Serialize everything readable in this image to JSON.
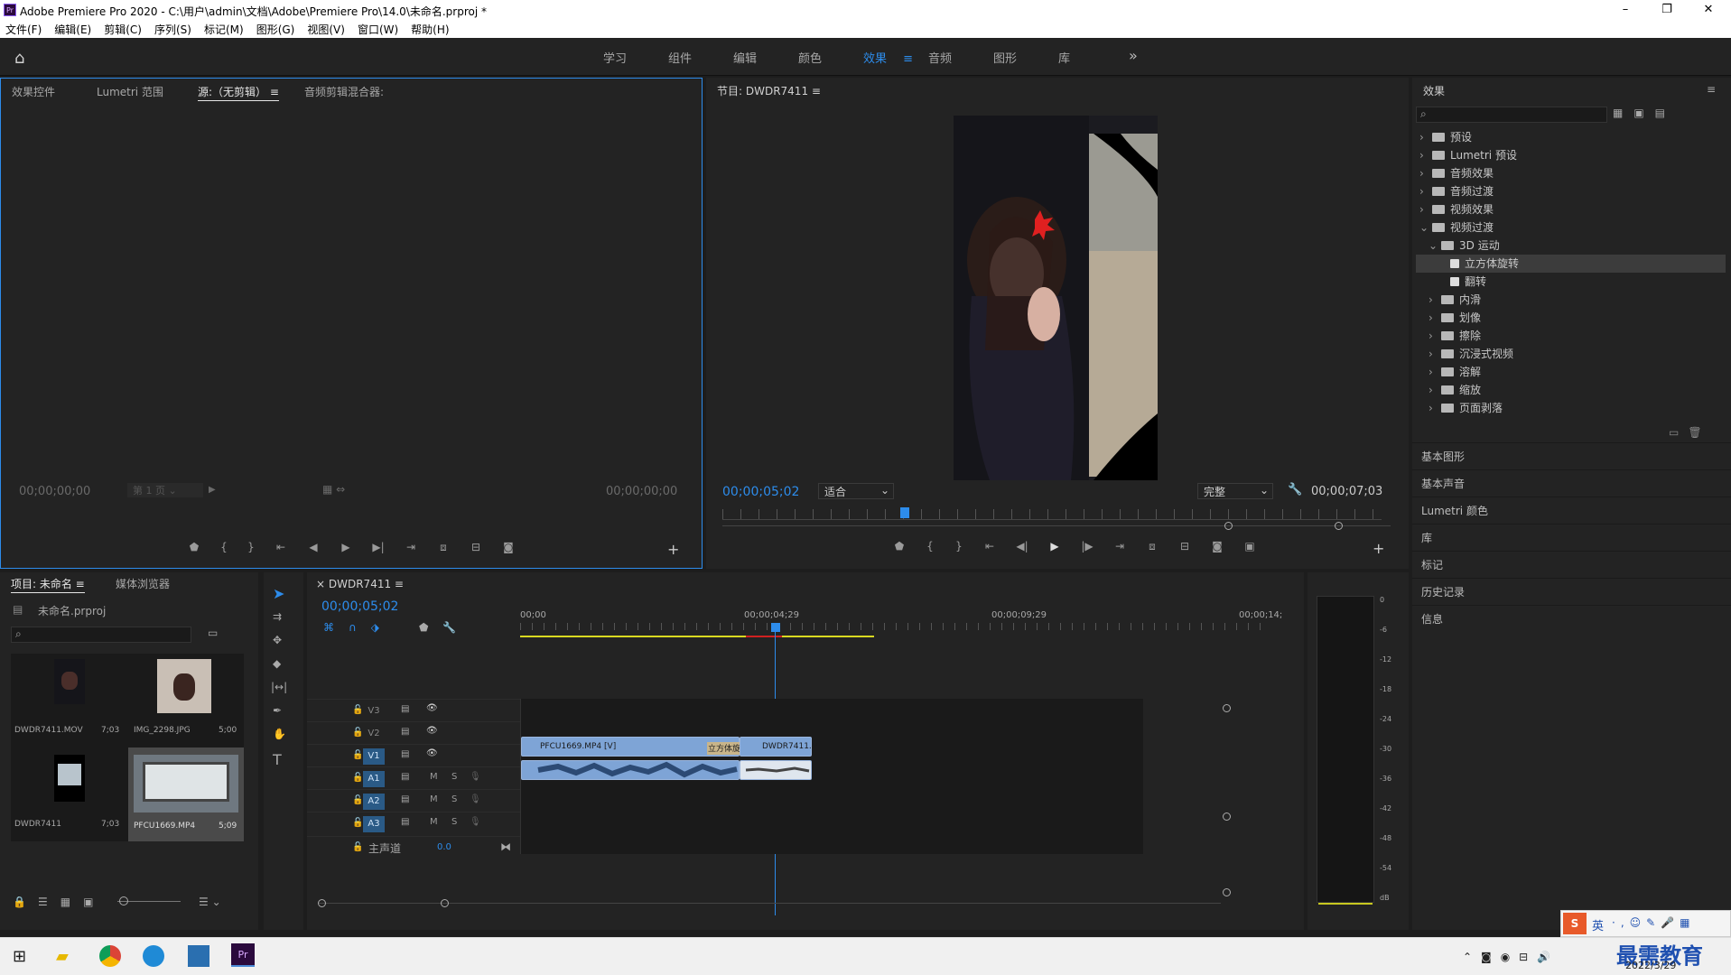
{
  "window": {
    "title": "Adobe Premiere Pro 2020 - C:\\用户\\admin\\文档\\Adobe\\Premiere Pro\\14.0\\未命名.prproj *",
    "minimize": "–",
    "maximize": "❐",
    "close": "✕",
    "logo": "Pr"
  },
  "menu": [
    "文件(F)",
    "编辑(E)",
    "剪辑(C)",
    "序列(S)",
    "标记(M)",
    "图形(G)",
    "视图(V)",
    "窗口(W)",
    "帮助(H)"
  ],
  "workspaces": [
    {
      "label": "学习"
    },
    {
      "label": "组件"
    },
    {
      "label": "编辑"
    },
    {
      "label": "颜色"
    },
    {
      "label": "效果",
      "active": true
    },
    {
      "label": "音频"
    },
    {
      "label": "图形"
    },
    {
      "label": "库"
    }
  ],
  "workspace_more": "»",
  "source": {
    "tabs": [
      "效果控件",
      "Lumetri 范围",
      "源:（无剪辑）",
      "音频剪辑混合器:"
    ],
    "active_tab": "源:（无剪辑）",
    "tc_left": "00;00;00;00",
    "page": "第 1 页",
    "tc_right": "00;00;00;00"
  },
  "program": {
    "title": "节目: DWDR7411",
    "timecode": "00;00;05;02",
    "fit": "适合",
    "quality": "完整",
    "duration": "00;00;07;03",
    "playhead_fraction": 0.27
  },
  "effects": {
    "title": "效果",
    "search_placeholder": "",
    "tree": [
      {
        "label": "预设",
        "level": 0,
        "expanded": false
      },
      {
        "label": "Lumetri 预设",
        "level": 0,
        "expanded": false
      },
      {
        "label": "音频效果",
        "level": 0,
        "expanded": false
      },
      {
        "label": "音频过渡",
        "level": 0,
        "expanded": false
      },
      {
        "label": "视频效果",
        "level": 0,
        "expanded": false
      },
      {
        "label": "视频过渡",
        "level": 0,
        "expanded": true
      },
      {
        "label": "3D 运动",
        "level": 1,
        "expanded": true
      },
      {
        "label": "立方体旋转",
        "level": 2,
        "item": true,
        "selected": true
      },
      {
        "label": "翻转",
        "level": 2,
        "item": true
      },
      {
        "label": "内滑",
        "level": 1,
        "expanded": false
      },
      {
        "label": "划像",
        "level": 1,
        "expanded": false
      },
      {
        "label": "擦除",
        "level": 1,
        "expanded": false
      },
      {
        "label": "沉浸式视频",
        "level": 1,
        "expanded": false
      },
      {
        "label": "溶解",
        "level": 1,
        "expanded": false
      },
      {
        "label": "缩放",
        "level": 1,
        "expanded": false
      },
      {
        "label": "页面剥落",
        "level": 1,
        "expanded": false
      }
    ],
    "sections": [
      "基本图形",
      "基本声音",
      "Lumetri 颜色",
      "库",
      "标记",
      "历史记录",
      "信息"
    ]
  },
  "project": {
    "tabs": [
      "项目: 未命名",
      "媒体浏览器"
    ],
    "file": "未命名.prproj",
    "items": [
      {
        "name": "DWDR7411.MOV",
        "dur": "7;03"
      },
      {
        "name": "IMG_2298.JPG",
        "dur": "5;00"
      },
      {
        "name": "DWDR7411",
        "dur": "7;03"
      },
      {
        "name": "PFCU1669.MP4",
        "dur": "5;09",
        "selected": true
      }
    ]
  },
  "timeline": {
    "tab": "DWDR7411",
    "timecode": "00;00;05;02",
    "ruler": [
      "00;00",
      "00;00;04;29",
      "00;00;09;29",
      "00;00;14;"
    ],
    "tracks": [
      "V3",
      "V2",
      "V1",
      "A1",
      "A2",
      "A3"
    ],
    "master_label": "主声道",
    "master_value": "0.0",
    "clips": {
      "v1a": "PFCU1669.MP4 [V]",
      "transition": "立方体旋",
      "v1b": "DWDR7411.M"
    },
    "mute": "M",
    "solo": "S"
  },
  "meter": {
    "scale": [
      "0",
      "-6",
      "-12",
      "-18",
      "-24",
      "-30",
      "-36",
      "-42",
      "-48",
      "-54",
      "dB"
    ]
  },
  "taskbar": {
    "date": "2022/3/29",
    "ime": "英",
    "watermark": "最需教育"
  }
}
